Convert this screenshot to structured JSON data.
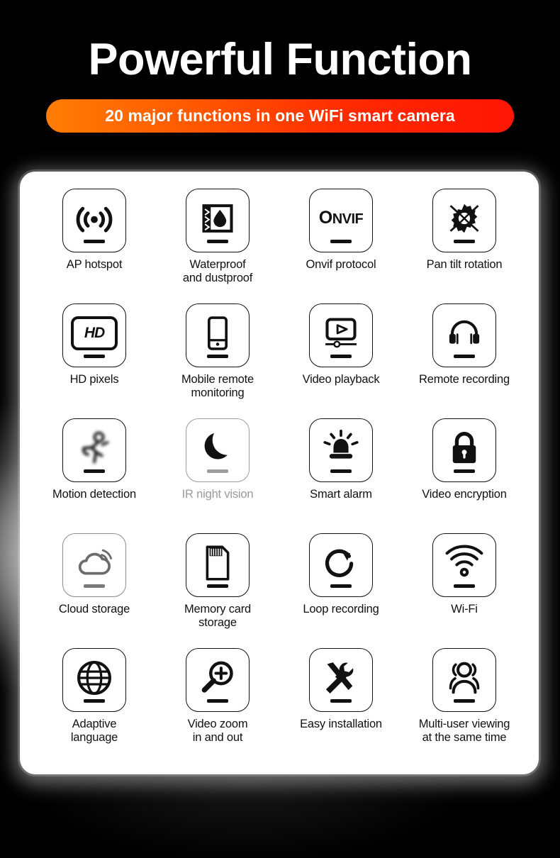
{
  "header": {
    "title": "Powerful Function",
    "subtitle": "20 major functions in one WiFi smart camera",
    "accent_gradient_from": "#ff7d05",
    "accent_gradient_to": "#ff1505"
  },
  "panel": {
    "background": "#ffffff",
    "columns": 4,
    "rows": 5,
    "features": [
      {
        "label": "AP hotspot",
        "icon": "ap-hotspot-icon",
        "state": "normal"
      },
      {
        "label": "Waterproof\nand dustproof",
        "icon": "waterproof-icon",
        "state": "normal"
      },
      {
        "label": "Onvif protocol",
        "icon": "onvif-logo-icon",
        "state": "normal"
      },
      {
        "label": "Pan tilt rotation",
        "icon": "pan-tilt-gear-icon",
        "state": "normal"
      },
      {
        "label": "HD pixels",
        "icon": "hd-pixels-icon",
        "state": "normal"
      },
      {
        "label": "Mobile remote\nmonitoring",
        "icon": "smartphone-icon",
        "state": "normal"
      },
      {
        "label": "Video playback",
        "icon": "video-playback-icon",
        "state": "normal"
      },
      {
        "label": "Remote recording",
        "icon": "headphones-icon",
        "state": "normal"
      },
      {
        "label": "Motion detection",
        "icon": "running-person-icon",
        "state": "blurred"
      },
      {
        "label": "IR night vision",
        "icon": "crescent-moon-icon",
        "state": "muted"
      },
      {
        "label": "Smart alarm",
        "icon": "alarm-siren-icon",
        "state": "normal"
      },
      {
        "label": "Video encryption",
        "icon": "padlock-icon",
        "state": "normal"
      },
      {
        "label": "Cloud storage",
        "icon": "cloud-signal-icon",
        "state": "softgray"
      },
      {
        "label": "Memory card\nstorage",
        "icon": "sd-card-icon",
        "state": "normal"
      },
      {
        "label": "Loop recording",
        "icon": "loop-arrow-icon",
        "state": "normal"
      },
      {
        "label": "Wi-Fi",
        "icon": "wifi-icon",
        "state": "normal"
      },
      {
        "label": "Adaptive\nlanguage",
        "icon": "globe-icon",
        "state": "normal"
      },
      {
        "label": "Video zoom\nin and out",
        "icon": "magnifier-plus-icon",
        "state": "normal"
      },
      {
        "label": "Easy installation",
        "icon": "wrench-screwdriver-icon",
        "state": "normal"
      },
      {
        "label": "Multi-user viewing\nat the same time",
        "icon": "multi-user-icon",
        "state": "normal"
      }
    ],
    "onvif_logo": {
      "o": "O",
      "rest": "NVIF"
    },
    "hd_badge": "HD"
  }
}
